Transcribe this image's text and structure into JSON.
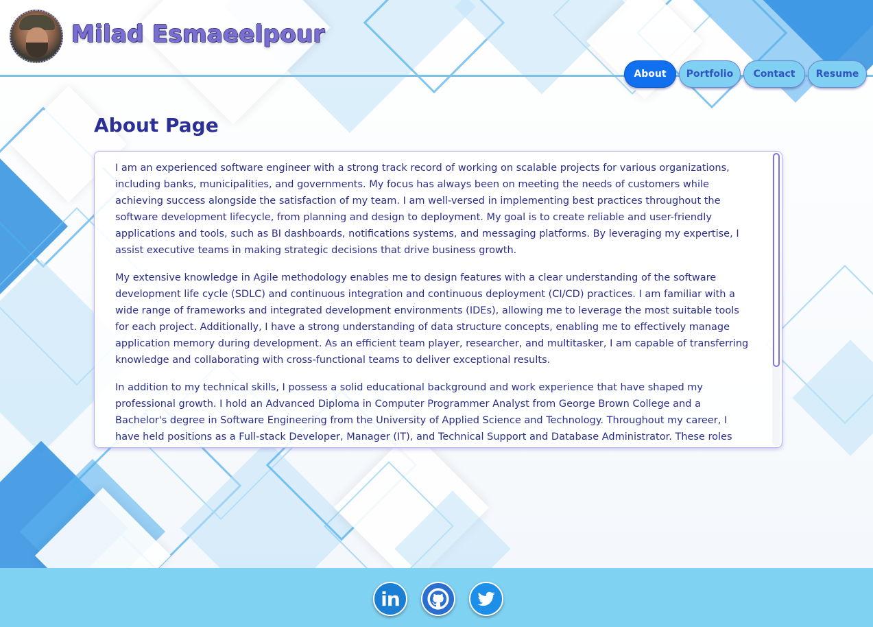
{
  "header": {
    "site_title": "Milad Esmaeelpour",
    "avatar_icon": "profile-photo"
  },
  "nav": {
    "items": [
      {
        "label": "About",
        "active": true
      },
      {
        "label": "Portfolio",
        "active": false
      },
      {
        "label": "Contact",
        "active": false
      },
      {
        "label": "Resume",
        "active": false
      }
    ]
  },
  "main": {
    "page_title": "About Page",
    "paragraphs": [
      "I am an experienced software engineer with a strong track record of working on scalable projects for various organizations, including banks, municipalities, and governments. My focus has always been on meeting the needs of customers while achieving success alongside the satisfaction of my team. I am well-versed in implementing best practices throughout the software development lifecycle, from planning and design to deployment. My goal is to create reliable and user-friendly applications and tools, such as BI dashboards, notifications systems, and messaging platforms. By leveraging my expertise, I assist executive teams in making strategic decisions that drive business growth.",
      "My extensive knowledge in Agile methodology enables me to design features with a clear understanding of the software development life cycle (SDLC) and continuous integration and continuous deployment (CI/CD) practices. I am familiar with a wide range of frameworks and integrated development environments (IDEs), allowing me to leverage the most suitable tools for each project. Additionally, I have a strong understanding of data structure concepts, enabling me to effectively manage application memory during development. As an efficient team player, researcher, and multitasker, I am capable of transferring knowledge and collaborating with cross-functional teams to deliver exceptional results.",
      "In addition to my technical skills, I possess a solid educational background and work experience that have shaped my professional growth. I hold an Advanced Diploma in Computer Programmer Analyst from George Brown College and a Bachelor's degree in Software Engineering from the University of Applied Science and Technology. Throughout my career, I have held positions as a Full-stack Developer, Manager (IT), and Technical Support and Database Administrator. These roles have"
    ]
  },
  "footer": {
    "social_icons": [
      "linkedin-icon",
      "github-icon",
      "twitter-icon"
    ]
  },
  "colors": {
    "accent": "#1070ee",
    "nav_bg": "#7fd0f2",
    "title_text": "#2c2f95",
    "footer_bg": "#80d2f2"
  }
}
